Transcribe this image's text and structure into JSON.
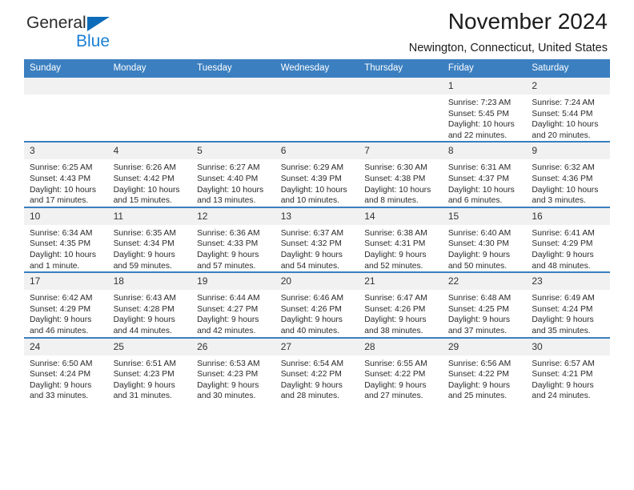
{
  "brand": {
    "name_part1": "General",
    "name_part2": "Blue",
    "accent_color": "#1a7fd4",
    "triangle_color": "#0d6cb9",
    "logo_icon": "blue-triangle-icon"
  },
  "header": {
    "title": "November 2024",
    "subtitle": "Newington, Connecticut, United States"
  },
  "theme": {
    "header_blue": "#3b7fc0",
    "daynum_band": "#f1f1f1",
    "text": "#2a2a2a"
  },
  "weekdays": [
    "Sunday",
    "Monday",
    "Tuesday",
    "Wednesday",
    "Thursday",
    "Friday",
    "Saturday"
  ],
  "weeks": [
    [
      {
        "day": "",
        "sunrise": "",
        "sunset": "",
        "daylight": "",
        "blank": true
      },
      {
        "day": "",
        "sunrise": "",
        "sunset": "",
        "daylight": "",
        "blank": true
      },
      {
        "day": "",
        "sunrise": "",
        "sunset": "",
        "daylight": "",
        "blank": true
      },
      {
        "day": "",
        "sunrise": "",
        "sunset": "",
        "daylight": "",
        "blank": true
      },
      {
        "day": "",
        "sunrise": "",
        "sunset": "",
        "daylight": "",
        "blank": true
      },
      {
        "day": "1",
        "sunrise": "Sunrise: 7:23 AM",
        "sunset": "Sunset: 5:45 PM",
        "daylight": "Daylight: 10 hours and 22 minutes."
      },
      {
        "day": "2",
        "sunrise": "Sunrise: 7:24 AM",
        "sunset": "Sunset: 5:44 PM",
        "daylight": "Daylight: 10 hours and 20 minutes."
      }
    ],
    [
      {
        "day": "3",
        "sunrise": "Sunrise: 6:25 AM",
        "sunset": "Sunset: 4:43 PM",
        "daylight": "Daylight: 10 hours and 17 minutes."
      },
      {
        "day": "4",
        "sunrise": "Sunrise: 6:26 AM",
        "sunset": "Sunset: 4:42 PM",
        "daylight": "Daylight: 10 hours and 15 minutes."
      },
      {
        "day": "5",
        "sunrise": "Sunrise: 6:27 AM",
        "sunset": "Sunset: 4:40 PM",
        "daylight": "Daylight: 10 hours and 13 minutes."
      },
      {
        "day": "6",
        "sunrise": "Sunrise: 6:29 AM",
        "sunset": "Sunset: 4:39 PM",
        "daylight": "Daylight: 10 hours and 10 minutes."
      },
      {
        "day": "7",
        "sunrise": "Sunrise: 6:30 AM",
        "sunset": "Sunset: 4:38 PM",
        "daylight": "Daylight: 10 hours and 8 minutes."
      },
      {
        "day": "8",
        "sunrise": "Sunrise: 6:31 AM",
        "sunset": "Sunset: 4:37 PM",
        "daylight": "Daylight: 10 hours and 6 minutes."
      },
      {
        "day": "9",
        "sunrise": "Sunrise: 6:32 AM",
        "sunset": "Sunset: 4:36 PM",
        "daylight": "Daylight: 10 hours and 3 minutes."
      }
    ],
    [
      {
        "day": "10",
        "sunrise": "Sunrise: 6:34 AM",
        "sunset": "Sunset: 4:35 PM",
        "daylight": "Daylight: 10 hours and 1 minute."
      },
      {
        "day": "11",
        "sunrise": "Sunrise: 6:35 AM",
        "sunset": "Sunset: 4:34 PM",
        "daylight": "Daylight: 9 hours and 59 minutes."
      },
      {
        "day": "12",
        "sunrise": "Sunrise: 6:36 AM",
        "sunset": "Sunset: 4:33 PM",
        "daylight": "Daylight: 9 hours and 57 minutes."
      },
      {
        "day": "13",
        "sunrise": "Sunrise: 6:37 AM",
        "sunset": "Sunset: 4:32 PM",
        "daylight": "Daylight: 9 hours and 54 minutes."
      },
      {
        "day": "14",
        "sunrise": "Sunrise: 6:38 AM",
        "sunset": "Sunset: 4:31 PM",
        "daylight": "Daylight: 9 hours and 52 minutes."
      },
      {
        "day": "15",
        "sunrise": "Sunrise: 6:40 AM",
        "sunset": "Sunset: 4:30 PM",
        "daylight": "Daylight: 9 hours and 50 minutes."
      },
      {
        "day": "16",
        "sunrise": "Sunrise: 6:41 AM",
        "sunset": "Sunset: 4:29 PM",
        "daylight": "Daylight: 9 hours and 48 minutes."
      }
    ],
    [
      {
        "day": "17",
        "sunrise": "Sunrise: 6:42 AM",
        "sunset": "Sunset: 4:29 PM",
        "daylight": "Daylight: 9 hours and 46 minutes."
      },
      {
        "day": "18",
        "sunrise": "Sunrise: 6:43 AM",
        "sunset": "Sunset: 4:28 PM",
        "daylight": "Daylight: 9 hours and 44 minutes."
      },
      {
        "day": "19",
        "sunrise": "Sunrise: 6:44 AM",
        "sunset": "Sunset: 4:27 PM",
        "daylight": "Daylight: 9 hours and 42 minutes."
      },
      {
        "day": "20",
        "sunrise": "Sunrise: 6:46 AM",
        "sunset": "Sunset: 4:26 PM",
        "daylight": "Daylight: 9 hours and 40 minutes."
      },
      {
        "day": "21",
        "sunrise": "Sunrise: 6:47 AM",
        "sunset": "Sunset: 4:26 PM",
        "daylight": "Daylight: 9 hours and 38 minutes."
      },
      {
        "day": "22",
        "sunrise": "Sunrise: 6:48 AM",
        "sunset": "Sunset: 4:25 PM",
        "daylight": "Daylight: 9 hours and 37 minutes."
      },
      {
        "day": "23",
        "sunrise": "Sunrise: 6:49 AM",
        "sunset": "Sunset: 4:24 PM",
        "daylight": "Daylight: 9 hours and 35 minutes."
      }
    ],
    [
      {
        "day": "24",
        "sunrise": "Sunrise: 6:50 AM",
        "sunset": "Sunset: 4:24 PM",
        "daylight": "Daylight: 9 hours and 33 minutes."
      },
      {
        "day": "25",
        "sunrise": "Sunrise: 6:51 AM",
        "sunset": "Sunset: 4:23 PM",
        "daylight": "Daylight: 9 hours and 31 minutes."
      },
      {
        "day": "26",
        "sunrise": "Sunrise: 6:53 AM",
        "sunset": "Sunset: 4:23 PM",
        "daylight": "Daylight: 9 hours and 30 minutes."
      },
      {
        "day": "27",
        "sunrise": "Sunrise: 6:54 AM",
        "sunset": "Sunset: 4:22 PM",
        "daylight": "Daylight: 9 hours and 28 minutes."
      },
      {
        "day": "28",
        "sunrise": "Sunrise: 6:55 AM",
        "sunset": "Sunset: 4:22 PM",
        "daylight": "Daylight: 9 hours and 27 minutes."
      },
      {
        "day": "29",
        "sunrise": "Sunrise: 6:56 AM",
        "sunset": "Sunset: 4:22 PM",
        "daylight": "Daylight: 9 hours and 25 minutes."
      },
      {
        "day": "30",
        "sunrise": "Sunrise: 6:57 AM",
        "sunset": "Sunset: 4:21 PM",
        "daylight": "Daylight: 9 hours and 24 minutes."
      }
    ]
  ]
}
